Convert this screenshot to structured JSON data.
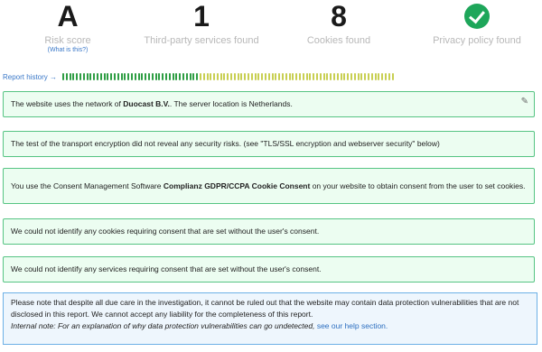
{
  "stats": [
    {
      "value": "A",
      "label": "Risk score",
      "sub": "(What is this?)"
    },
    {
      "value": "1",
      "label": "Third-party services found"
    },
    {
      "value": "8",
      "label": "Cookies found"
    },
    {
      "icon": "check-icon",
      "label": "Privacy policy found"
    }
  ],
  "history": {
    "label": "Report history",
    "arrow": "→",
    "green_count": 40,
    "olive_count": 57,
    "colors": {
      "green": "#2f9e44",
      "olive": "#c8cf52"
    }
  },
  "findings": [
    {
      "pre": "The website uses the network of ",
      "bold": "Duocast B.V.",
      "post": ". The server location is Netherlands."
    },
    {
      "pre": "The test of the transport encryption did not reveal any security risks. (see \"TLS/SSL encryption and webserver security\" below)",
      "bold": "",
      "post": ""
    },
    {
      "pre": "You use the Consent Management Software ",
      "bold": "Complianz GDPR/CCPA Cookie Consent",
      "post": " on your website to obtain consent from the user to set cookies."
    },
    {
      "pre": "We could not identify any cookies requiring consent that are set without the user's consent.",
      "bold": "",
      "post": ""
    },
    {
      "pre": "We could not identify any services requiring consent that are set without the user's consent.",
      "bold": "",
      "post": ""
    }
  ],
  "note": {
    "text": "Please note that despite all due care in the investigation, it cannot be ruled out that the website may contain data protection vulnerabilities that are not disclosed in this report. We cannot accept any liability for the completeness of this report.",
    "internal": "Internal note: For an explanation of why data protection vulnerabilities can go undetected,",
    "link": "see our help section."
  },
  "colors": {
    "accent_green": "#1e9e45",
    "box_border": "#56c483",
    "box_bg": "#ecfdf1",
    "note_border": "#6db0e6",
    "note_bg": "#eef6fd"
  }
}
